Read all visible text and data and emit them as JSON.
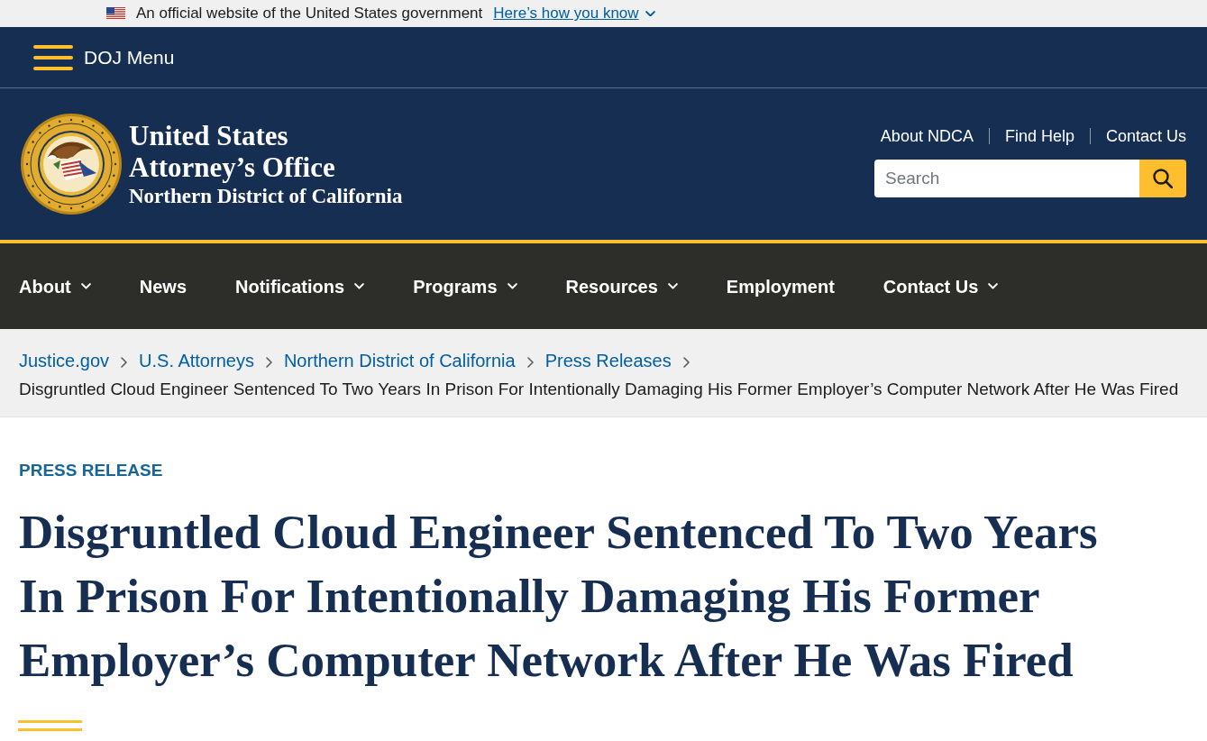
{
  "gov_banner": {
    "text": "An official website of the United States government",
    "link": "Here’s how you know"
  },
  "doj_menu": {
    "label": "DOJ Menu"
  },
  "header": {
    "title": "United States Attorney’s Office",
    "subtitle": "Northern District of California",
    "utility_links": [
      "About NDCA",
      "Find Help",
      "Contact Us"
    ],
    "search": {
      "placeholder": "Search"
    }
  },
  "main_nav": [
    {
      "label": "About",
      "has_dropdown": true
    },
    {
      "label": "News",
      "has_dropdown": false
    },
    {
      "label": "Notifications",
      "has_dropdown": true
    },
    {
      "label": "Programs",
      "has_dropdown": true
    },
    {
      "label": "Resources",
      "has_dropdown": true
    },
    {
      "label": "Employment",
      "has_dropdown": false
    },
    {
      "label": "Contact Us",
      "has_dropdown": true
    }
  ],
  "breadcrumb": [
    {
      "label": "Justice.gov",
      "kind": "link"
    },
    {
      "label": "U.S. Attorneys",
      "kind": "link"
    },
    {
      "label": "Northern District of California",
      "kind": "link"
    },
    {
      "label": "Press Releases",
      "kind": "link"
    },
    {
      "label": "Disgruntled Cloud Engineer Sentenced To Two Years In Prison For Intentionally Damaging His Former Employer’s Computer Network After He Was Fired",
      "kind": "current"
    }
  ],
  "article": {
    "eyebrow": "PRESS RELEASE",
    "title": "Disgruntled Cloud Engineer Sentenced To Two Years In Prison For Intentionally Damaging His Former Employer’s Computer Network After He Was Fired"
  }
}
